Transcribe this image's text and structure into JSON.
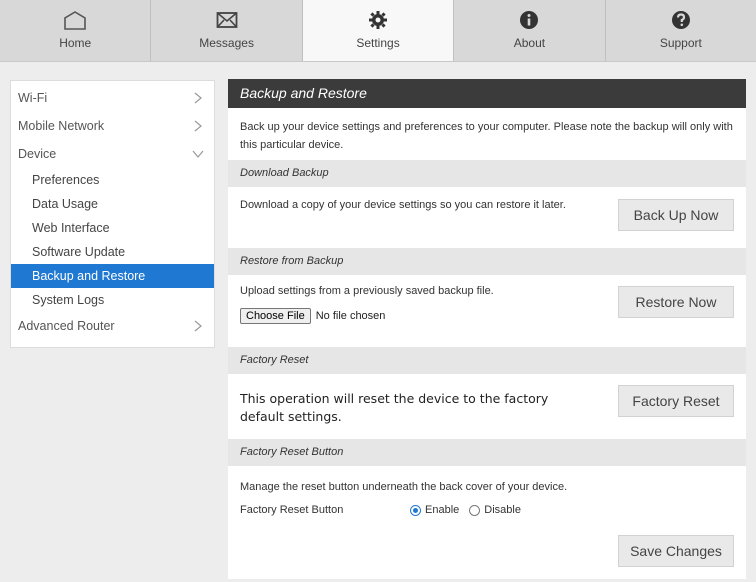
{
  "nav": {
    "tabs": [
      {
        "label": "Home",
        "icon": "home-icon"
      },
      {
        "label": "Messages",
        "icon": "envelope-icon"
      },
      {
        "label": "Settings",
        "icon": "gear-icon",
        "active": true
      },
      {
        "label": "About",
        "icon": "info-icon"
      },
      {
        "label": "Support",
        "icon": "question-icon"
      }
    ]
  },
  "sidebar": {
    "wifi": "Wi-Fi",
    "mobile_network": "Mobile Network",
    "device": "Device",
    "device_items": [
      "Preferences",
      "Data Usage",
      "Web Interface",
      "Software Update",
      "Backup and Restore",
      "System Logs"
    ],
    "active_item": "Backup and Restore",
    "advanced_router": "Advanced Router"
  },
  "main": {
    "title": "Backup and Restore",
    "intro": "Back up your device settings and preferences to your computer. Please note the backup will only with this particular device.",
    "download": {
      "heading": "Download Backup",
      "text": "Download a copy of your device settings so you can restore it later.",
      "button": "Back Up Now"
    },
    "restore": {
      "heading": "Restore from Backup",
      "text": "Upload settings from a previously saved backup file.",
      "choose_file": "Choose File",
      "no_file": "No file chosen",
      "button": "Restore Now"
    },
    "factory": {
      "heading": "Factory Reset",
      "text": "This operation will reset the device to the factory default settings.",
      "button": "Factory Reset"
    },
    "reset_button": {
      "heading": "Factory Reset Button",
      "text": "Manage the reset button underneath the back cover of your device.",
      "label": "Factory Reset Button",
      "enable": "Enable",
      "disable": "Disable",
      "selected": "Enable",
      "save": "Save Changes"
    }
  },
  "colors": {
    "accent": "#1f78d1",
    "header_bg": "#3b3b3b",
    "section_bg": "#e6e6e6"
  }
}
